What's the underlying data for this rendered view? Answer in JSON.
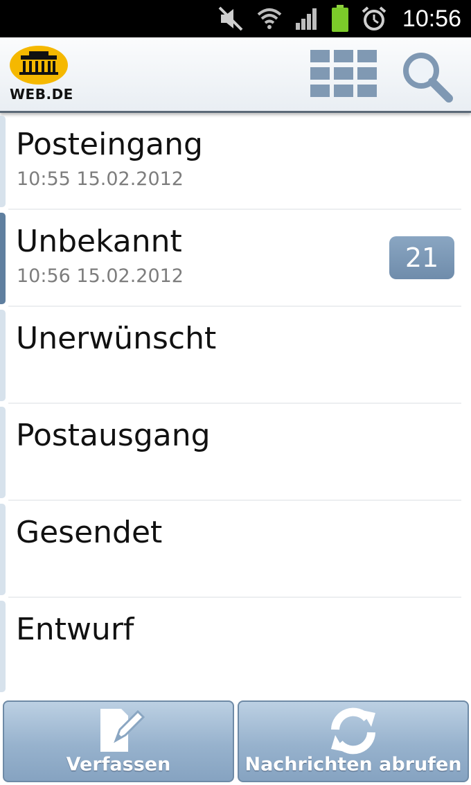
{
  "status_bar": {
    "time": "10:56",
    "icons": [
      "mute-icon",
      "wifi-icon",
      "signal-icon",
      "battery-icon",
      "alarm-icon"
    ]
  },
  "header": {
    "logo_text": "WEB.DE",
    "actions": [
      "grid-menu-icon",
      "search-icon"
    ]
  },
  "folders": [
    {
      "name": "Posteingang",
      "date": "10:55 15.02.2012",
      "badge": ""
    },
    {
      "name": "Unbekannt",
      "date": "10:56 15.02.2012",
      "badge": "21"
    },
    {
      "name": "Unerwünscht",
      "date": "",
      "badge": ""
    },
    {
      "name": "Postausgang",
      "date": "",
      "badge": ""
    },
    {
      "name": "Gesendet",
      "date": "",
      "badge": ""
    },
    {
      "name": "Entwurf",
      "date": "",
      "badge": ""
    }
  ],
  "bottom_bar": {
    "compose_label": "Verfassen",
    "fetch_label": "Nachrichten abrufen"
  },
  "colors": {
    "accent": "#6f8cab",
    "logo_yellow": "#f5b800",
    "header_icon": "#7f98b3"
  }
}
